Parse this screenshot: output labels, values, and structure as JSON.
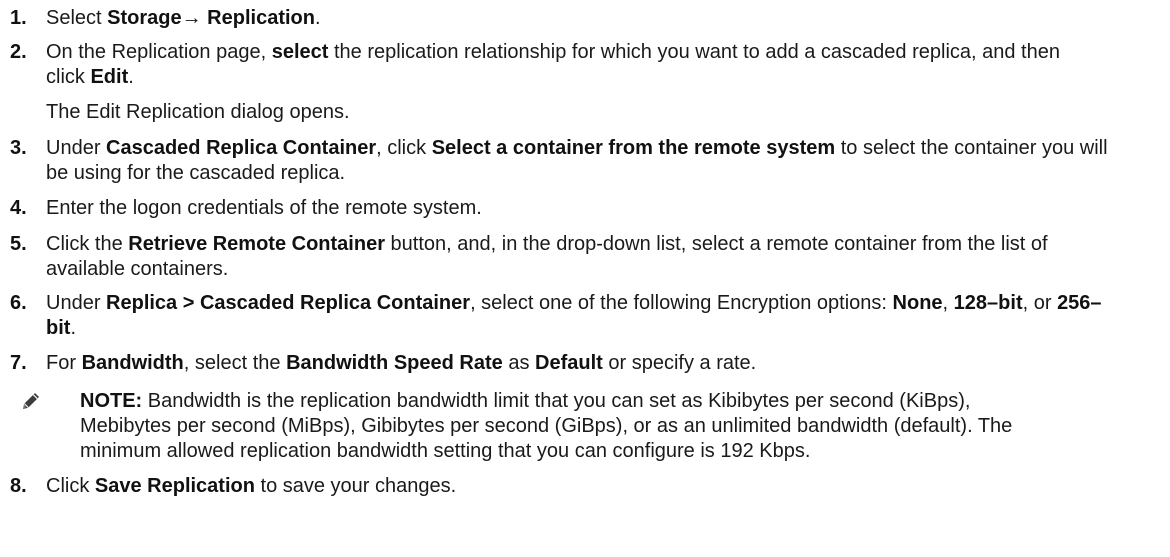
{
  "steps": [
    {
      "number": "1.",
      "parts": [
        "Select ",
        "Storage→ Replication",
        "."
      ]
    },
    {
      "number": "2.",
      "parts": [
        "On the Replication page, ",
        "select",
        " the replication relationship for which you want to add a cascaded replica, and then",
        "click ",
        "Edit",
        "."
      ],
      "result": "The Edit Replication dialog opens."
    },
    {
      "number": "3.",
      "parts": [
        "Under ",
        "Cascaded Replica Container",
        ", click ",
        "Select a container from the remote system",
        " to select the container you will",
        "be using for the cascaded replica."
      ]
    },
    {
      "number": "4.",
      "parts": [
        "Enter the logon credentials of the remote system."
      ]
    },
    {
      "number": "5.",
      "parts": [
        "Click the ",
        "Retrieve Remote Container",
        " button, and, in the drop-down list, select a remote container from the list of",
        "available containers."
      ]
    },
    {
      "number": "6.",
      "parts": [
        "Under ",
        "Replica > Cascaded Replica Container",
        ", select one of the following Encryption options: ",
        "None",
        ", ",
        "128–bit",
        ", or ",
        "256–",
        "bit",
        "."
      ]
    },
    {
      "number": "7.",
      "parts": [
        "For ",
        "Bandwidth",
        ", select the ",
        "Bandwidth Speed Rate",
        " as ",
        "Default",
        " or specify a rate."
      ],
      "note": {
        "icon": "pencil-note-icon",
        "label": "NOTE:",
        "lines": [
          " Bandwidth is the replication bandwidth limit that you can set as Kibibytes per second (KiBps),",
          "Mebibytes per second (MiBps), Gibibytes per second (GiBps), or as an unlimited bandwidth (default). The",
          "minimum allowed replication bandwidth setting that you can configure is 192 Kbps."
        ]
      }
    },
    {
      "number": "8.",
      "parts": [
        "Click ",
        "Save Replication",
        " to save your changes."
      ]
    }
  ]
}
